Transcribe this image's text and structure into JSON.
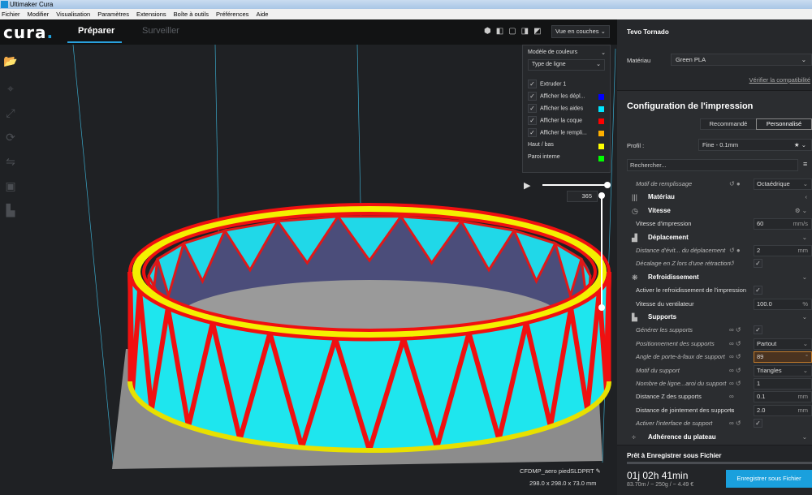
{
  "window": {
    "title": "Ultimaker Cura"
  },
  "menu": [
    "Fichier",
    "Modifier",
    "Visualisation",
    "Paramètres",
    "Extensions",
    "Boîte à outils",
    "Préférences",
    "Aide"
  ],
  "header": {
    "logo": "cura",
    "tabs": [
      "Préparer",
      "Surveiller"
    ]
  },
  "view": {
    "mode": "Vue en couches",
    "color_scheme_label": "Modèle de couleurs",
    "color_scheme": "Type de ligne",
    "items": [
      {
        "label": "Extruder 1",
        "checked": true
      },
      {
        "label": "Afficher les dépl...",
        "checked": true,
        "color": "#0000ff"
      },
      {
        "label": "Afficher les aides",
        "checked": true,
        "color": "#00e5ff"
      },
      {
        "label": "Afficher la coque",
        "checked": true,
        "color": "#ff0000"
      },
      {
        "label": "Afficher le rempli...",
        "checked": true,
        "color": "#ffb000"
      }
    ],
    "legend": [
      {
        "label": "Haut / bas",
        "color": "#ffff00"
      },
      {
        "label": "Paroi interne",
        "color": "#00ff00"
      }
    ],
    "layer": "365"
  },
  "object": {
    "name": "CFDMP_aero piedSLDPRT",
    "dimensions": "298.0 x 298.0 x 73.0 mm"
  },
  "printer": {
    "name": "Tevo Tornado",
    "material_label": "Matériau",
    "material": "Green PLA",
    "compat_link": "Vérifier la compatibilité"
  },
  "config": {
    "title": "Configuration de l'impression",
    "modes": [
      "Recommandé",
      "Personnalisé"
    ],
    "profile_label": "Profil :",
    "profile": "Fine - 0.1mm",
    "search_placeholder": "Rechercher...",
    "rows": [
      {
        "type": "it",
        "label": "Motif de remplissage",
        "icons": "↺ ●",
        "value": "Octaédrique",
        "select": true
      },
      {
        "type": "cat",
        "label": "Matériau",
        "icon": "|||",
        "chev": "‹"
      },
      {
        "type": "cat",
        "label": "Vitesse",
        "icon": "◷",
        "chev": "⚙ ⌄"
      },
      {
        "type": "n",
        "label": "Vitesse d'impression",
        "value": "60",
        "unit": "mm/s"
      },
      {
        "type": "cat",
        "label": "Déplacement",
        "icon": "▟",
        "chev": "⌄"
      },
      {
        "type": "it",
        "label": "Distance d'évit... du déplacement",
        "icons": "↺ ●",
        "value": "2",
        "unit": "mm"
      },
      {
        "type": "it",
        "label": "Décalage en Z lors d'une rétraction",
        "icons": "  ↺",
        "check": true
      },
      {
        "type": "cat",
        "label": "Refroidissement",
        "icon": "❋",
        "chev": "⌄"
      },
      {
        "type": "n",
        "label": "Activer le refroidissement de l'impression",
        "check": true
      },
      {
        "type": "n",
        "label": "Vitesse du ventilateur",
        "value": "100.0",
        "unit": "%"
      },
      {
        "type": "cat",
        "label": "Supports",
        "icon": "▙",
        "chev": "⌄"
      },
      {
        "type": "it",
        "label": "Générer les supports",
        "icons": "∞ ↺",
        "check": true
      },
      {
        "type": "it",
        "label": "Positionnement des supports",
        "icons": "∞ ↺",
        "value": "Partout",
        "select": true
      },
      {
        "type": "it",
        "label": "Angle de porte-à-faux de support",
        "icons": "∞ ↺",
        "value": "89",
        "unit": "°",
        "error": true
      },
      {
        "type": "it",
        "label": "Motif du support",
        "icons": "∞ ↺",
        "value": "Triangles",
        "select": true
      },
      {
        "type": "it",
        "label": "Nombre de ligne...aroi du support",
        "icons": "∞ ↺",
        "value": "1"
      },
      {
        "type": "n",
        "label": "Distance Z des supports",
        "icons": "  ∞",
        "value": "0.1",
        "unit": "mm"
      },
      {
        "type": "n",
        "label": "Distance de jointement des supports",
        "icons": "  ∞",
        "value": "2.0",
        "unit": "mm"
      },
      {
        "type": "it",
        "label": "Activer l'interface de support",
        "icons": "∞ ↺",
        "check": true
      },
      {
        "type": "cat",
        "label": "Adhérence du plateau",
        "icon": "÷",
        "chev": "⌄"
      }
    ]
  },
  "output": {
    "status": "Prêt à Enregistrer sous Fichier",
    "time": "01j 02h 41min",
    "stats": "83.70m / ~ 250g / ~ 4.49 €",
    "save_label": "Enregistrer sous Fichier"
  }
}
